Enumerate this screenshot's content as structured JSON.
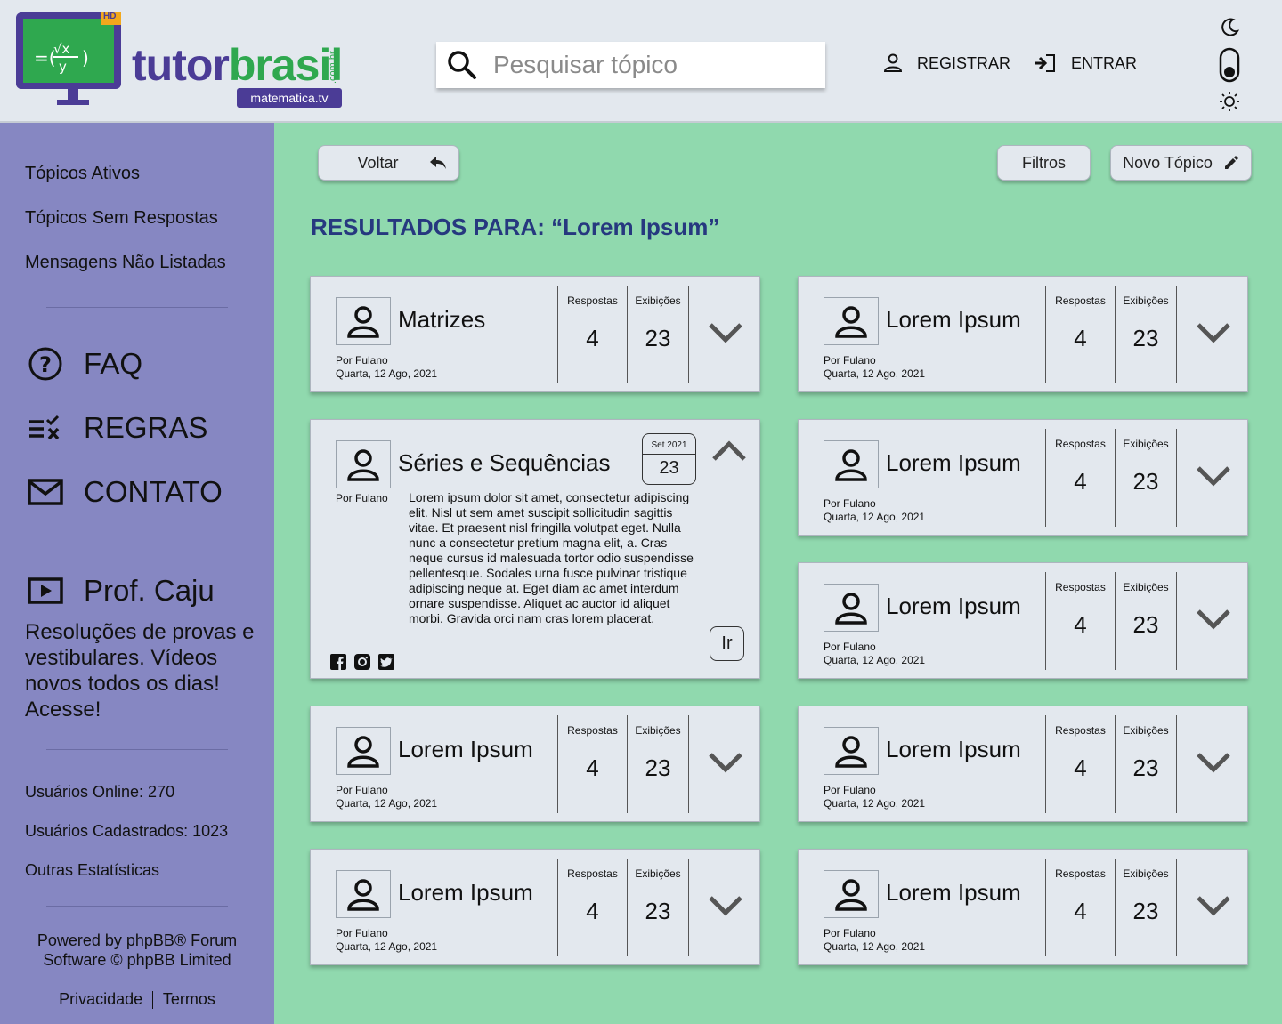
{
  "header": {
    "logo_main": "tutorbrasil",
    "logo_domain": ".com.br",
    "logo_sub": "matematica.tv",
    "logo_badge": "HD",
    "search_placeholder": "Pesquisar tópico",
    "register_label": "REGISTRAR",
    "login_label": "ENTRAR"
  },
  "sidebar": {
    "links": [
      "Tópicos Ativos",
      "Tópicos Sem Respostas",
      "Mensagens Não Listadas"
    ],
    "faq": "FAQ",
    "rules": "REGRAS",
    "contact": "CONTATO",
    "prof": "Prof. Caju",
    "prof_desc": "Resoluções de provas e vestibulares. Vídeos novos todos os dias! Acesse!",
    "stats": [
      "Usuários Online: 270",
      "Usuários Cadastrados: 1023",
      "Outras Estatísticas"
    ],
    "footer": "Powered by phpBB® Forum Software © phpBB Limited",
    "privacy": "Privacidade",
    "terms": "Termos"
  },
  "toolbar": {
    "back": "Voltar",
    "filters": "Filtros",
    "new_topic": "Novo Tópico"
  },
  "results_title": "RESULTADOS PARA: “Lorem Ipsum”",
  "labels": {
    "replies": "Respostas",
    "views": "Exibições"
  },
  "cards": [
    {
      "title": "Matrizes",
      "by": "Por Fulano",
      "date": "Quarta, 12 Ago, 2021",
      "replies": "4",
      "views": "23"
    },
    {
      "title": "Lorem Ipsum",
      "by": "Por Fulano",
      "date": "Quarta, 12 Ago, 2021",
      "replies": "4",
      "views": "23"
    },
    {
      "title": "Séries e Sequências",
      "by": "Por Fulano",
      "badge_month": "Set 2021",
      "badge_day": "23",
      "body": "Lorem ipsum dolor sit amet, consectetur adipiscing elit. Nisl ut sem amet suscipit sollicitudin sagittis vitae. Et praesent nisl fringilla volutpat eget. Nulla nunc a consectetur pretium magna elit, a. Cras neque cursus id malesuada tortor odio suspendisse pellentesque. Sodales urna fusce pulvinar tristique adipiscing neque at. Eget diam ac amet interdum ornare suspendisse. Aliquet ac auctor id aliquet morbi. Gravida orci nam cras lorem placerat.",
      "go": "Ir"
    },
    {
      "title": "Lorem Ipsum",
      "by": "Por Fulano",
      "date": "Quarta, 12 Ago, 2021",
      "replies": "4",
      "views": "23"
    },
    {
      "title": "Lorem Ipsum",
      "by": "Por Fulano",
      "date": "Quarta, 12 Ago, 2021",
      "replies": "4",
      "views": "23"
    },
    {
      "title": "Lorem Ipsum",
      "by": "Por Fulano",
      "date": "Quarta, 12 Ago, 2021",
      "replies": "4",
      "views": "23"
    },
    {
      "title": "Lorem Ipsum",
      "by": "Por Fulano",
      "date": "Quarta, 12 Ago, 2021",
      "replies": "4",
      "views": "23"
    },
    {
      "title": "Lorem Ipsum",
      "by": "Por Fulano",
      "date": "Quarta, 12 Ago, 2021",
      "replies": "4",
      "views": "23"
    },
    {
      "title": "Lorem Ipsum",
      "by": "Por Fulano",
      "date": "Quarta, 12 Ago, 2021",
      "replies": "4",
      "views": "23"
    }
  ],
  "colors": {
    "header_bg": "#e3e8ee",
    "sidebar_bg": "#8687c2",
    "main_bg": "#90d9ae",
    "title_color": "#26387f",
    "logo_green": "#2fa84f",
    "logo_purple": "#4b3c96"
  }
}
